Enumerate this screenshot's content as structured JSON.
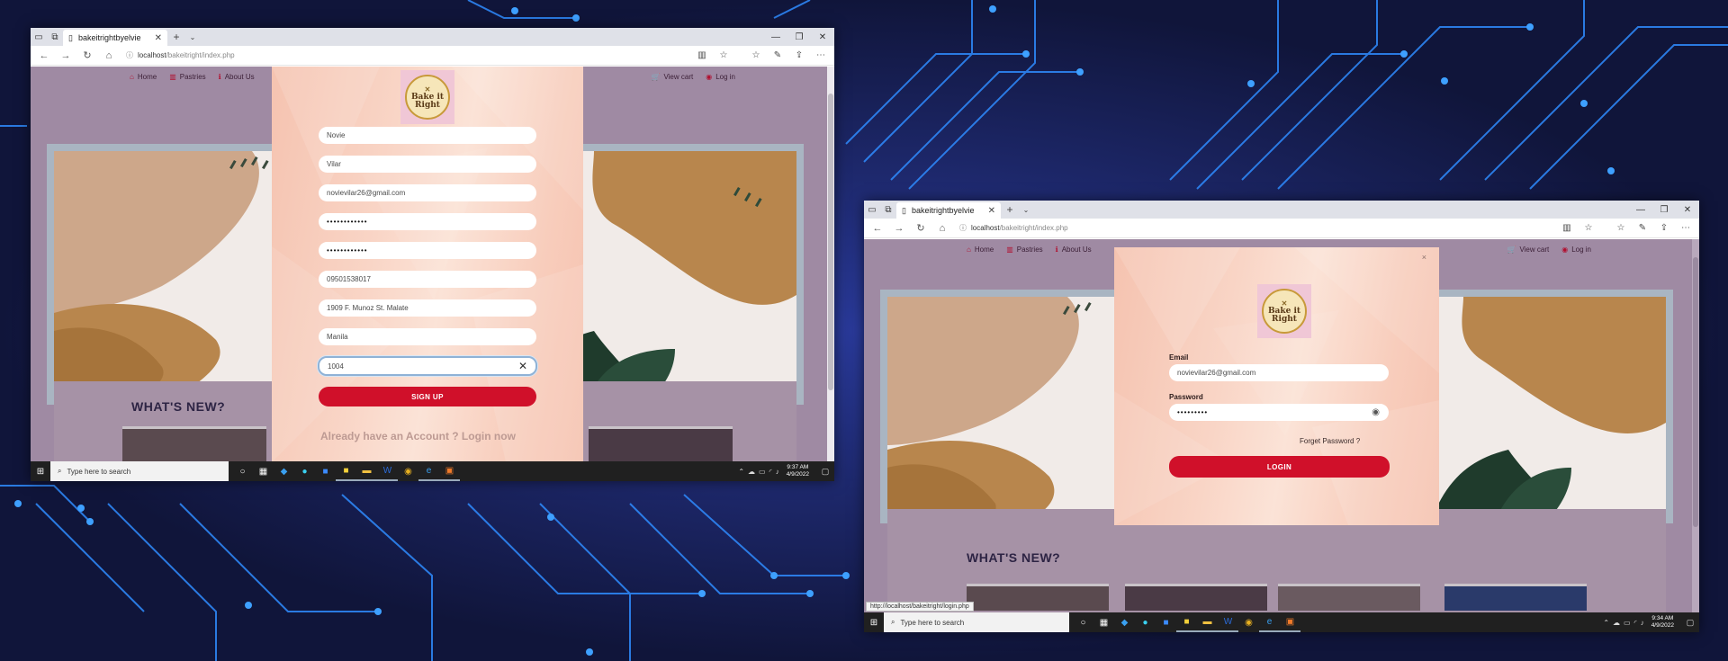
{
  "win1": {
    "tab_title": "bakeitrightbyelvie",
    "url_host": "localhost",
    "url_path": "/bakeitright/index.php",
    "nav": [
      {
        "icon": "home-icon",
        "glyph": "⌂",
        "label": "Home"
      },
      {
        "icon": "pastries-icon",
        "glyph": "▥",
        "label": "Pastries"
      },
      {
        "icon": "info-icon",
        "glyph": "ℹ",
        "label": "About Us"
      }
    ],
    "nav_right": [
      {
        "icon": "cart-icon",
        "glyph": "🛒",
        "label": "View cart"
      },
      {
        "icon": "user-icon",
        "glyph": "◉",
        "label": "Log in"
      }
    ],
    "logo_text_1": "Bake it",
    "logo_text_2": "Right",
    "signup": {
      "fields": [
        {
          "name": "first-name-field",
          "value": "Novie"
        },
        {
          "name": "last-name-field",
          "value": "Vilar"
        },
        {
          "name": "email-field",
          "value": "novievilar26@gmail.com"
        },
        {
          "name": "password-field",
          "value": "••••••••••••"
        },
        {
          "name": "confirm-password-field",
          "value": "••••••••••••"
        },
        {
          "name": "phone-field",
          "value": "09501538017"
        },
        {
          "name": "address-field",
          "value": "1909 F. Munoz St. Malate"
        },
        {
          "name": "city-field",
          "value": "Manila"
        },
        {
          "name": "zip-field",
          "value": "1004"
        }
      ],
      "button": "SIGN UP",
      "login_prompt": "Already have an Account ? Login now"
    },
    "whats_new": "WHAT'S NEW?",
    "clock_time": "9:37 AM",
    "clock_date": "4/9/2022"
  },
  "win2": {
    "tab_title": "bakeitrightbyelvie",
    "url_host": "localhost",
    "url_path": "/bakeitright/index.php",
    "nav": [
      {
        "icon": "home-icon",
        "glyph": "⌂",
        "label": "Home"
      },
      {
        "icon": "pastries-icon",
        "glyph": "▥",
        "label": "Pastries"
      },
      {
        "icon": "info-icon",
        "glyph": "ℹ",
        "label": "About Us"
      }
    ],
    "nav_right": [
      {
        "icon": "cart-icon",
        "glyph": "🛒",
        "label": "View cart"
      },
      {
        "icon": "user-icon",
        "glyph": "◉",
        "label": "Log in"
      }
    ],
    "logo_text_1": "Bake it",
    "logo_text_2": "Right",
    "login": {
      "email_label": "Email",
      "email_value": "novievilar26@gmail.com",
      "password_label": "Password",
      "password_value": "•••••••••",
      "forgot": "Forget Password ?",
      "button": "LOGIN",
      "close": "×"
    },
    "whats_new": "WHAT'S NEW?",
    "status_url": "http://localhost/bakeitright/login.php",
    "clock_time": "9:34 AM",
    "clock_date": "4/9/2022"
  },
  "taskbar": {
    "search_placeholder": "Type here to search"
  }
}
